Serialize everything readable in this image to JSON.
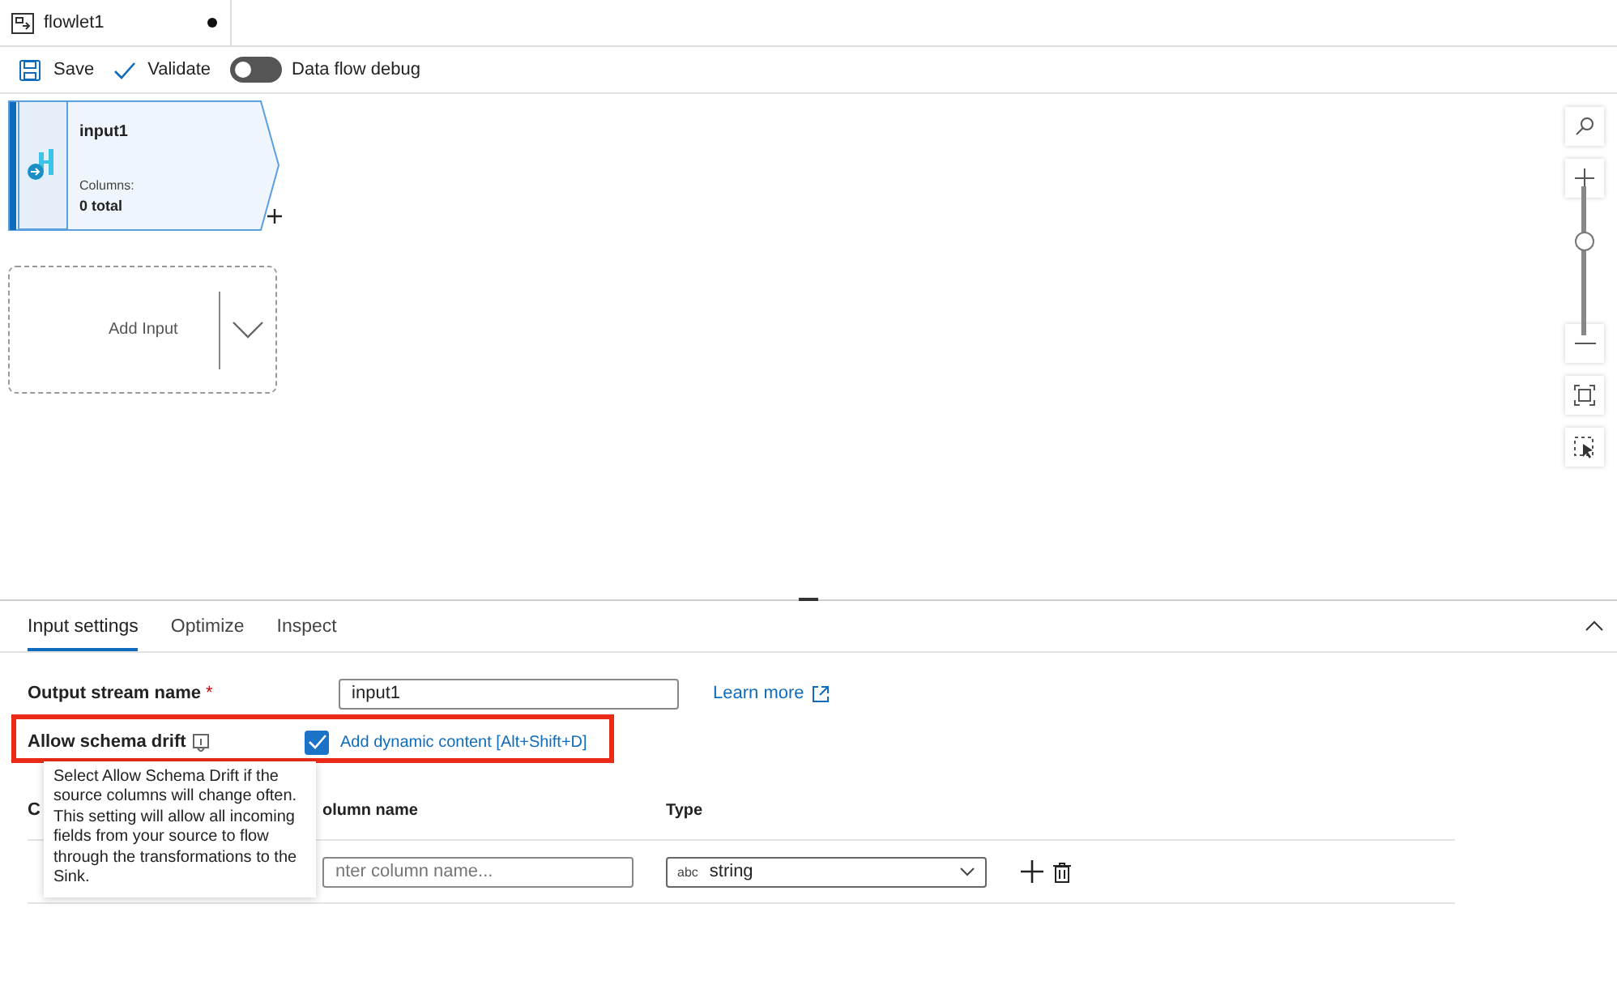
{
  "tab": {
    "title": "flowlet1",
    "unsaved": true
  },
  "toolbar": {
    "buttons": [
      {
        "kind": "save",
        "label": "Save"
      },
      {
        "kind": "validate",
        "label": "Validate"
      }
    ],
    "debug_toggle": {
      "label": "Data flow debug",
      "on": false
    }
  },
  "canvas": {
    "nodes": [
      {
        "kind": "source",
        "title": "input1",
        "columns_label": "Columns:",
        "columns_value": "0 total",
        "selected": true
      },
      {
        "kind": "add",
        "label": "Add Input"
      }
    ],
    "zoom": {
      "level": 0.64
    }
  },
  "panel": {
    "tabs": [
      {
        "label": "Input settings",
        "selected": true
      },
      {
        "label": "Optimize",
        "selected": false
      },
      {
        "label": "Inspect",
        "selected": false
      }
    ],
    "output_stream": {
      "label": "Output stream name",
      "required_mark": "*",
      "value": "input1",
      "link": "Learn more"
    },
    "schema_drift": {
      "label": "Allow schema drift",
      "checked": true,
      "dynamic_link": "Add dynamic content [Alt+Shift+D]",
      "highlighted": true
    },
    "columns_label": "C",
    "table": {
      "columns": [
        "olumn name",
        "Type"
      ],
      "rows": [
        {
          "name_placeholder": "nter column name...",
          "type_icon": "abc",
          "type": "string"
        }
      ]
    },
    "tooltip": "Select Allow Schema Drift if the source columns will change often. This setting will allow all incoming fields from your source to flow through the transformations to the Sink."
  }
}
